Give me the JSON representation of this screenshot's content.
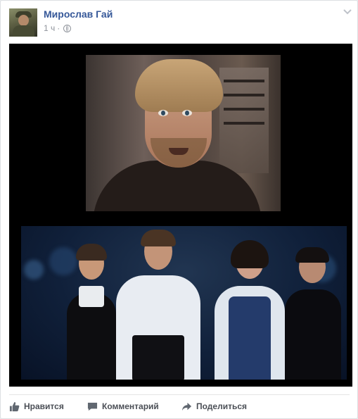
{
  "post": {
    "author": "Мирослав Гай",
    "time": "1 ч",
    "separator": "·",
    "privacy_icon": "globe-icon"
  },
  "actions": [
    {
      "label": "Нравится",
      "icon": "thumbs-up-icon"
    },
    {
      "label": "Комментарий",
      "icon": "comment-icon"
    },
    {
      "label": "Поделиться",
      "icon": "share-icon"
    }
  ],
  "colors": {
    "author_link": "#365899",
    "meta_text": "#90949c",
    "action_text": "#4b4f56",
    "background": "#e9ebee"
  }
}
